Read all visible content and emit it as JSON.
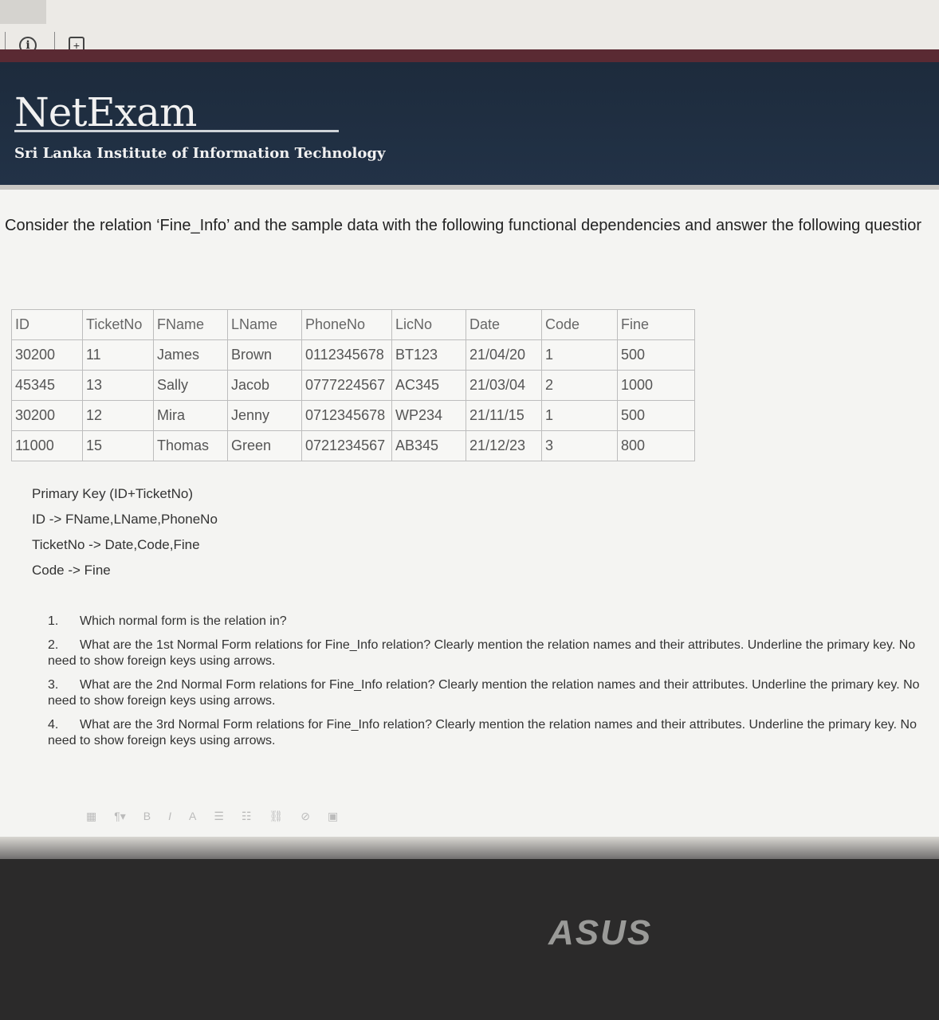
{
  "header": {
    "logo": "NetExam",
    "institute": "Sri Lanka Institute of Information Technology"
  },
  "question": {
    "intro": "Consider the relation ‘Fine_Info’ and the sample data with the following functional dependencies and answer the following questior"
  },
  "table": {
    "columns": [
      "ID",
      "TicketNo",
      "FName",
      "LName",
      "PhoneNo",
      "LicNo",
      "Date",
      "Code",
      "Fine"
    ],
    "rows": [
      [
        "30200",
        "11",
        "James",
        "Brown",
        "0112345678",
        "BT123",
        "21/04/20",
        "1",
        "500"
      ],
      [
        "45345",
        "13",
        "Sally",
        "Jacob",
        "0777224567",
        "AC345",
        "21/03/04",
        "2",
        "1000"
      ],
      [
        "30200",
        "12",
        "Mira",
        "Jenny",
        "0712345678",
        "WP234",
        "21/11/15",
        "1",
        "500"
      ],
      [
        "11000",
        "15",
        "Thomas",
        "Green",
        "0721234567",
        "AB345",
        "21/12/23",
        "3",
        "800"
      ]
    ]
  },
  "dependencies": {
    "primary_key": "Primary Key (ID+TicketNo)",
    "fd1": "ID -> FName,LName,PhoneNo",
    "fd2": "TicketNo -> Date,Code,Fine",
    "fd3": "Code -> Fine"
  },
  "questions": [
    {
      "num": "1.",
      "text": "Which normal form is the relation in?"
    },
    {
      "num": "2.",
      "text": "What are the 1st Normal Form relations for Fine_Info relation? Clearly mention the relation names and their attributes. Underline the primary key. No need to show foreign keys using arrows."
    },
    {
      "num": "3.",
      "text": "What are the 2nd Normal Form relations for Fine_Info relation? Clearly mention the relation names and their attributes. Underline the primary key. No need to show foreign keys using arrows."
    },
    {
      "num": "4.",
      "text": "What are the 3rd Normal Form relations for Fine_Info relation? Clearly mention the relation names and their attributes. Underline the primary key. No need to show foreign keys using arrows."
    }
  ],
  "toolbar": {
    "bold": "B",
    "italic": "I",
    "font_color": "A"
  },
  "bezel": {
    "brand": "ASUS"
  }
}
